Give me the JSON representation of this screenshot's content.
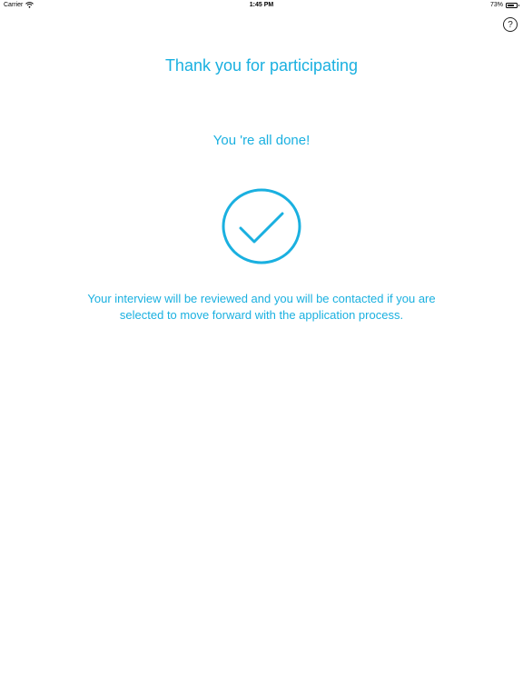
{
  "status_bar": {
    "carrier": "Carrier",
    "time": "1:45 PM",
    "battery_percent_label": "73%",
    "battery_level": 0.73,
    "icons": [
      "wifi-icon",
      "battery-icon"
    ]
  },
  "help": {
    "label": "?",
    "icon": "question-circle-icon"
  },
  "main": {
    "title": "Thank you for participating",
    "subtitle": "You 're all done!",
    "check_icon": "checkmark-circle-icon",
    "message_line1": "Your interview will be reviewed and you will be contacted if you are",
    "message_line2": "selected to move forward with the application process."
  },
  "colors": {
    "accent": "#1ab0e0",
    "background": "#ffffff",
    "text_dark": "#000000"
  }
}
